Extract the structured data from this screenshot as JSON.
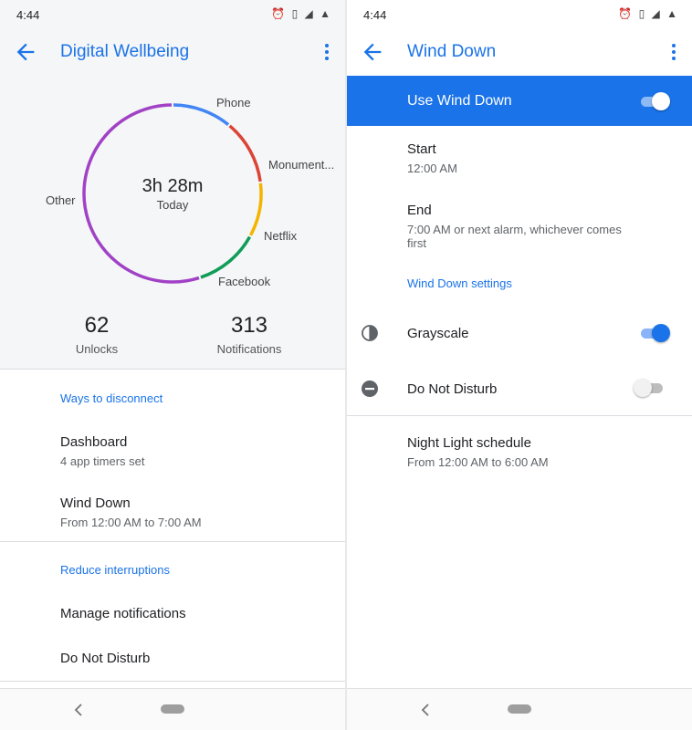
{
  "left": {
    "status": {
      "time": "4:44",
      "icons": "⏰ ▯ ◢ ▲"
    },
    "title": "Digital Wellbeing",
    "chart_data": {
      "type": "pie",
      "center_value": "3h 28m",
      "center_label": "Today",
      "slices": [
        {
          "name": "Phone",
          "fraction": 0.11,
          "color": "#4285f4"
        },
        {
          "name": "Monument...",
          "fraction": 0.12,
          "color": "#db4437"
        },
        {
          "name": "Netflix",
          "fraction": 0.1,
          "color": "#f4b400"
        },
        {
          "name": "Facebook",
          "fraction": 0.12,
          "color": "#0f9d58"
        },
        {
          "name": "Other",
          "fraction": 0.55,
          "color": "#a142c6"
        }
      ]
    },
    "stats": {
      "unlocks_value": "62",
      "unlocks_label": "Unlocks",
      "notifications_value": "313",
      "notifications_label": "Notifications"
    },
    "section_disconnect": "Ways to disconnect",
    "dashboard": {
      "primary": "Dashboard",
      "secondary": "4 app timers set"
    },
    "wind_down": {
      "primary": "Wind Down",
      "secondary": "From 12:00 AM to 7:00 AM"
    },
    "section_interruptions": "Reduce interruptions",
    "manage_notifications": "Manage notifications",
    "do_not_disturb": "Do Not Disturb"
  },
  "right": {
    "status": {
      "time": "4:44",
      "icons": "⏰ ▯ ◢ ▲"
    },
    "title": "Wind Down",
    "use_wind_down": {
      "label": "Use Wind Down",
      "on": true
    },
    "start": {
      "primary": "Start",
      "secondary": "12:00 AM"
    },
    "end": {
      "primary": "End",
      "secondary": "7:00 AM or next alarm, whichever comes first"
    },
    "settings_link": "Wind Down settings",
    "grayscale": {
      "label": "Grayscale",
      "on": true
    },
    "dnd": {
      "label": "Do Not Disturb",
      "on": false
    },
    "night_light": {
      "primary": "Night Light schedule",
      "secondary": "From 12:00 AM to 6:00 AM"
    }
  },
  "colors": {
    "accent": "#1a73e8",
    "banner": "#1a73e8"
  }
}
